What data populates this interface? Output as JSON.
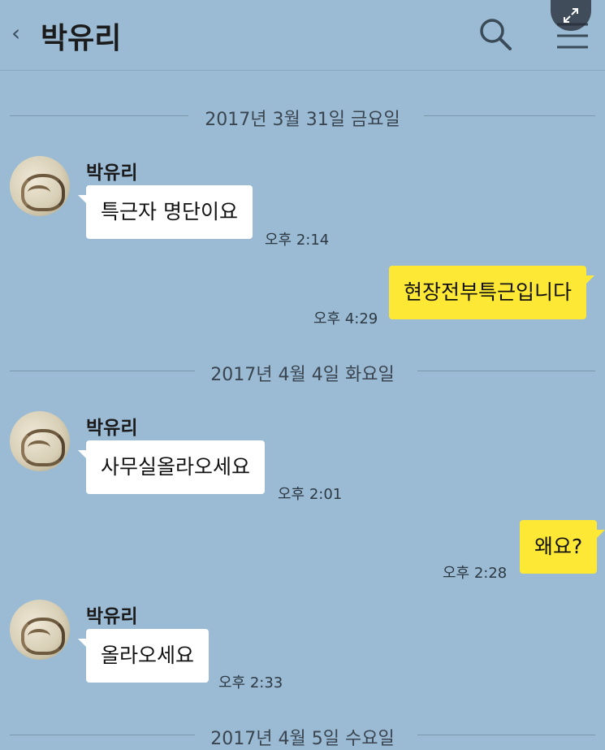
{
  "header": {
    "back_glyph": "‹",
    "title": "박유리",
    "icons": [
      "search-icon",
      "menu-icon",
      "expand-icon"
    ]
  },
  "dates": [
    "2017년 3월 31일 금요일",
    "2017년 4월 4일 화요일",
    "2017년 4월 5일 수요일"
  ],
  "messages": [
    {
      "sender": "박유리",
      "text": "특근자 명단이요",
      "time": "오후 2:14"
    },
    {
      "text": "현장전부특근입니다",
      "time": "오후 4:29"
    },
    {
      "sender": "박유리",
      "text": "사무실올라오세요",
      "time": "오후 2:01"
    },
    {
      "text": "왜요?",
      "time": "오후 2:28"
    },
    {
      "sender": "박유리",
      "text": "올라오세요",
      "time": "오후 2:33"
    }
  ],
  "colors": {
    "background": "#9bbbd4",
    "incoming_bubble": "#ffffff",
    "outgoing_bubble": "#fee836"
  }
}
